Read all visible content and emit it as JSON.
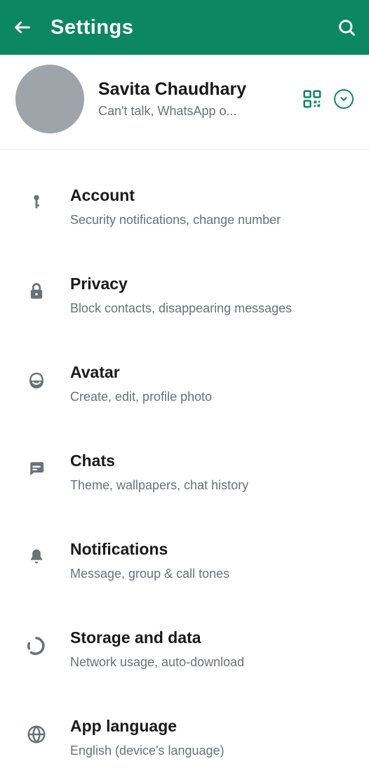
{
  "header": {
    "title": "Settings"
  },
  "profile": {
    "name": "Savita Chaudhary",
    "status": "Can't talk, WhatsApp o..."
  },
  "settings": [
    {
      "icon": "key",
      "title": "Account",
      "subtitle": "Security notifications, change number"
    },
    {
      "icon": "lock",
      "title": "Privacy",
      "subtitle": "Block contacts, disappearing messages"
    },
    {
      "icon": "avatar-face",
      "title": "Avatar",
      "subtitle": "Create, edit, profile photo"
    },
    {
      "icon": "chat",
      "title": "Chats",
      "subtitle": "Theme, wallpapers, chat history"
    },
    {
      "icon": "bell",
      "title": "Notifications",
      "subtitle": "Message, group & call tones"
    },
    {
      "icon": "data-circle",
      "title": "Storage and data",
      "subtitle": "Network usage, auto-download"
    },
    {
      "icon": "globe",
      "title": "App language",
      "subtitle": "English (device's language)"
    }
  ]
}
